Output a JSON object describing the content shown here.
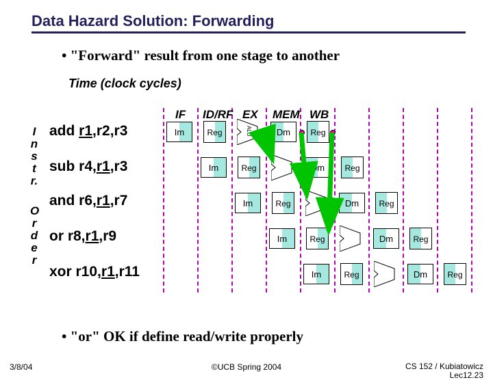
{
  "title": "Data Hazard Solution: Forwarding",
  "bullets": {
    "b1": "• \"Forward\" result from one stage to another",
    "b2": "• \"or\" OK if define read/write properly"
  },
  "time_label": "Time (clock cycles)",
  "side_label_top": "I\nn\ns\nt\nr.",
  "side_label_bot": "O\nr\nd\ne\nr",
  "stages": {
    "if": "IF",
    "id": "ID/RF",
    "ex": "EX",
    "mem": "MEM",
    "wb": "WB"
  },
  "boxes": {
    "im": "Im",
    "reg": "Reg",
    "dm": "Dm",
    "alu": "ALU"
  },
  "instrs": [
    {
      "op": "add ",
      "ureg": "r1",
      "rest": ",r2,r3"
    },
    {
      "op": "sub r4,",
      "ureg": "r1",
      "rest": ",r3"
    },
    {
      "op": "and r6,",
      "ureg": "r1",
      "rest": ",r7"
    },
    {
      "op": "or   r8,",
      "ureg": "r1",
      "rest": ",r9"
    },
    {
      "op": "xor r10,",
      "ureg": "r1",
      "rest": ",r11"
    }
  ],
  "footer": {
    "date": "3/8/04",
    "center": "©UCB Spring 2004",
    "right1": "CS 152 / Kubiatowicz",
    "right2": "Lec12.23"
  },
  "colors": {
    "title": "#231f5a",
    "dash": "#b300b3",
    "tint": "#a4e8e0",
    "arrow": "#00c400",
    "dot": "#ff00a8"
  }
}
